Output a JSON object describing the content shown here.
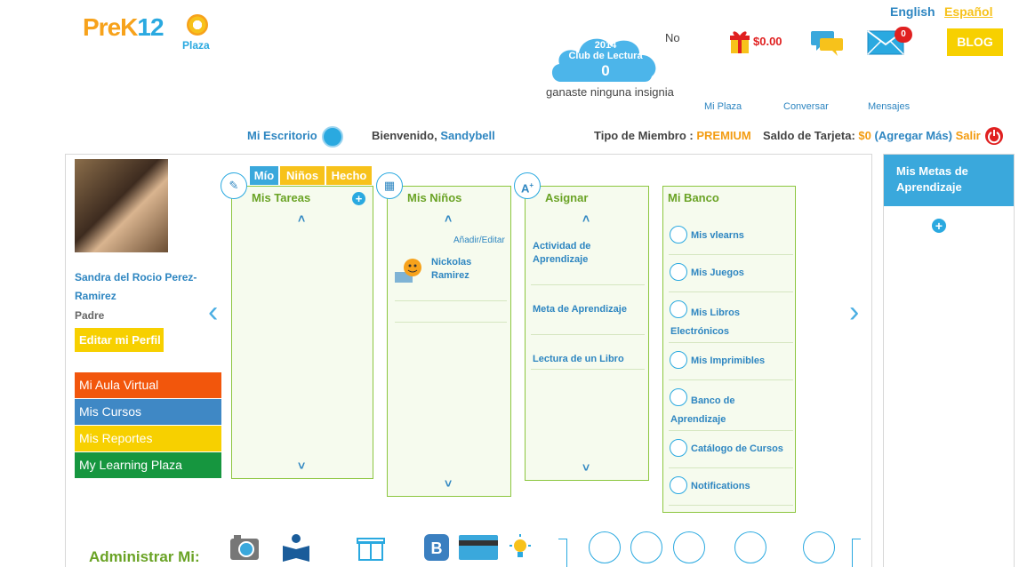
{
  "logo": {
    "main": "PreK",
    "digits": "12",
    "sub": "Plaza"
  },
  "language": {
    "english": "English",
    "spanish": "Español"
  },
  "reading_club": {
    "year": "2014",
    "label": "Club de Lectura",
    "count": "0",
    "no": "No",
    "badge_text": "ganaste ninguna insignia"
  },
  "header": {
    "cart_amount": "$0.00",
    "mail_count": "0",
    "blog": "BLOG",
    "nav_plaza": "Mi Plaza",
    "nav_chat": "Conversar",
    "nav_mail": "Mensajes"
  },
  "bar": {
    "escritorio": "Mi Escritorio",
    "welcome": "Bienvenido,",
    "user": "Sandybell",
    "member_label": "Tipo de Miembro :",
    "member_value": "PREMIUM",
    "balance_label": "Saldo de Tarjeta:",
    "balance_value": "$0",
    "add_more": "(Agregar Más)",
    "logout": "Salir"
  },
  "profile": {
    "name": "Sandra del Rocio Perez-Ramirez",
    "role": "Padre",
    "edit": "Editar mi Perfil"
  },
  "side_menu": [
    "Mi Aula Virtual",
    "Mis Cursos",
    "Mis Reportes",
    "My Learning Plaza"
  ],
  "tasks": {
    "tabs": [
      "Mío",
      "Niños",
      "Hecho"
    ],
    "title": "Mis Tareas"
  },
  "kids": {
    "title": "Mis Niños",
    "add_edit": "Añadir/Editar",
    "child_first": "Nickolas",
    "child_last": "Ramirez"
  },
  "assign": {
    "title": "Asignar",
    "items": [
      "Actividad de Aprendizaje",
      "Meta de Aprendizaje",
      "Lectura de un Libro"
    ]
  },
  "bank": {
    "title": "Mi Banco",
    "items": [
      "Mis vlearns",
      "Mis Juegos",
      "Mis Libros Electrónicos",
      "Mis Imprimibles",
      "Banco de Aprendizaje",
      "Catálogo de Cursos",
      "Notifications"
    ]
  },
  "goals": {
    "title": "Mis Metas de Aprendizaje"
  },
  "bottom": {
    "label": "Administrar Mi:"
  },
  "colors": {
    "accent_blue": "#3aa8dc",
    "green": "#8cc63f",
    "yellow": "#f7d000",
    "orange": "#f2560c",
    "red": "#e02020"
  },
  "icons": [
    "gift-icon",
    "chat-icon",
    "mail-icon",
    "power-icon",
    "pencil-icon",
    "blocks-icon",
    "grade-icon",
    "camera-icon",
    "reader-icon",
    "present-icon",
    "card-icon",
    "bulb-icon"
  ]
}
